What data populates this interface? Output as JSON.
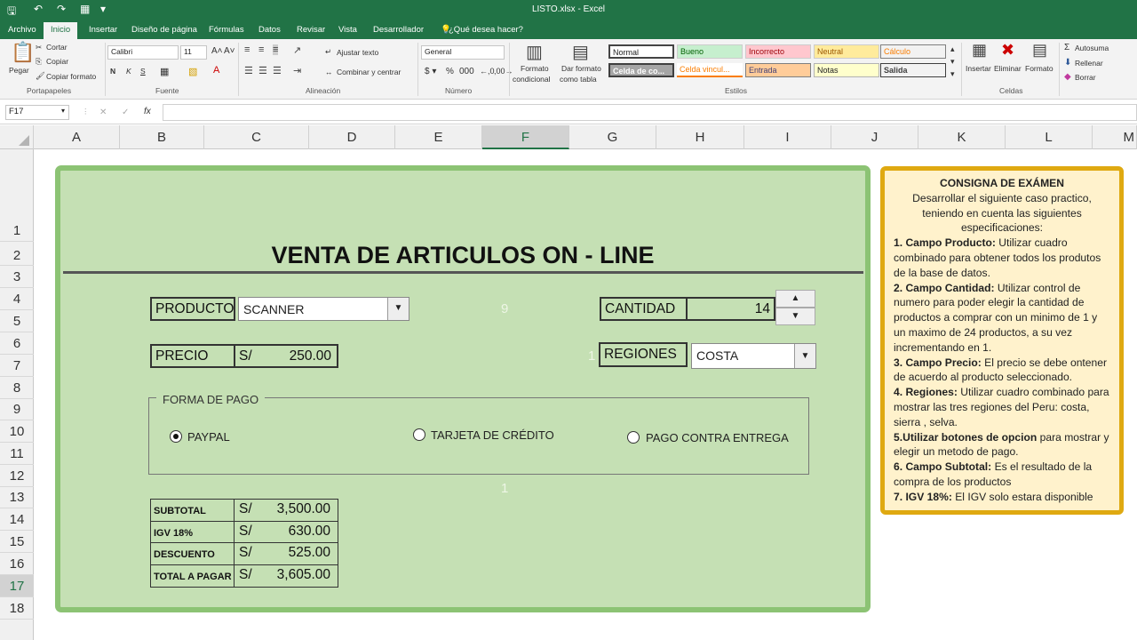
{
  "window": {
    "title": "LISTO.xlsx - Excel"
  },
  "ribbon_tabs": [
    "Archivo",
    "Inicio",
    "Insertar",
    "Diseño de página",
    "Fórmulas",
    "Datos",
    "Revisar",
    "Vista",
    "Desarrollador",
    "¿Qué desea hacer?"
  ],
  "ribbon": {
    "paste": "Pegar",
    "cut": "Cortar",
    "copy": "Copiar",
    "copy_format": "Copiar formato",
    "font_name": "Calibri",
    "font_size": "11",
    "wrap_text": "Ajustar texto",
    "merge_center": "Combinar y centrar",
    "number_format": "General",
    "cond_format_1": "Formato",
    "cond_format_2": "condicional",
    "format_table_1": "Dar formato",
    "format_table_2": "como tabla",
    "styles": [
      "Normal",
      "Bueno",
      "Incorrecto",
      "Neutral",
      "Cálculo",
      "Celda de co...",
      "Celda vincul...",
      "Entrada",
      "Notas",
      "Salida"
    ],
    "insert": "Insertar",
    "delete": "Eliminar",
    "format": "Formato",
    "autosum": "Autosuma",
    "fill": "Rellenar",
    "clear": "Borrar",
    "group_labels": [
      "Portapapeles",
      "Fuente",
      "Alineación",
      "Número",
      "Estilos",
      "Celdas"
    ]
  },
  "formula_bar": {
    "name_box": "F17",
    "fx": "fx",
    "value": ""
  },
  "columns": [
    "A",
    "B",
    "C",
    "D",
    "E",
    "F",
    "G",
    "H",
    "I",
    "J",
    "K",
    "L",
    "M"
  ],
  "rows": [
    "1",
    "2",
    "3",
    "4",
    "5",
    "6",
    "7",
    "8",
    "9",
    "10",
    "11",
    "12",
    "13",
    "14",
    "15",
    "16",
    "17",
    "18"
  ],
  "selected_cell": "F17",
  "form": {
    "title": "VENTA DE ARTICULOS ON - LINE",
    "producto_label": "PRODUCTO",
    "producto_value": "SCANNER",
    "cantidad_label": "CANTIDAD",
    "cantidad_value": "14",
    "precio_label": "PRECIO",
    "currency": "S/",
    "precio_value": "250.00",
    "regiones_label": "REGIONES",
    "regiones_value": "COSTA",
    "hidden_9": "9",
    "hidden_1a": "1",
    "hidden_1b": "1",
    "pago_legend": "FORMA DE PAGO",
    "pago_options": [
      "PAYPAL",
      "TARJETA DE CRÉDITO",
      "PAGO CONTRA ENTREGA"
    ],
    "pago_selected": "PAYPAL",
    "totals": [
      {
        "label": "SUBTOTAL",
        "value": "3,500.00"
      },
      {
        "label": "IGV 18%",
        "value": "630.00"
      },
      {
        "label": "DESCUENTO",
        "value": "525.00"
      },
      {
        "label": "TOTAL A PAGAR",
        "value": "3,605.00"
      }
    ]
  },
  "instructions": {
    "heading": "CONSIGNA DE EXÁMEN",
    "intro": "Desarrollar el siguiente caso practico, teniendo en cuenta las siguientes especificaciones:",
    "items": [
      {
        "bold": "1. Campo Producto:",
        "text": " Utilizar cuadro combinado para obtener todos los produtos de la base de datos."
      },
      {
        "bold": "2. Campo Cantidad:",
        "text": " Utilizar control de numero para poder elegir la cantidad de productos a comprar con un minimo de 1 y un maximo de 24 productos, a su vez incrementando en 1."
      },
      {
        "bold": "3. Campo Precio:",
        "text": " El precio se debe ontener de acuerdo al producto seleccionado."
      },
      {
        "bold": "4. Regiones:",
        "text": " Utilizar cuadro combinado para mostrar las tres regiones del Peru: costa, sierra , selva."
      },
      {
        "bold": "5.Utilizar botones de opcion",
        "text": " para mostrar y elegir un metodo de pago."
      },
      {
        "bold": "6. Campo Subtotal:",
        "text": " Es el resultado de la compra de los productos"
      },
      {
        "bold": "7. IGV 18%:",
        "text": " El IGV solo estara disponible"
      }
    ]
  },
  "colors": {
    "excel_green": "#217346",
    "form_bg": "#c5e0b4",
    "form_border": "#8cc374",
    "note_bg": "#fff2cc",
    "note_border": "#dfa911"
  }
}
